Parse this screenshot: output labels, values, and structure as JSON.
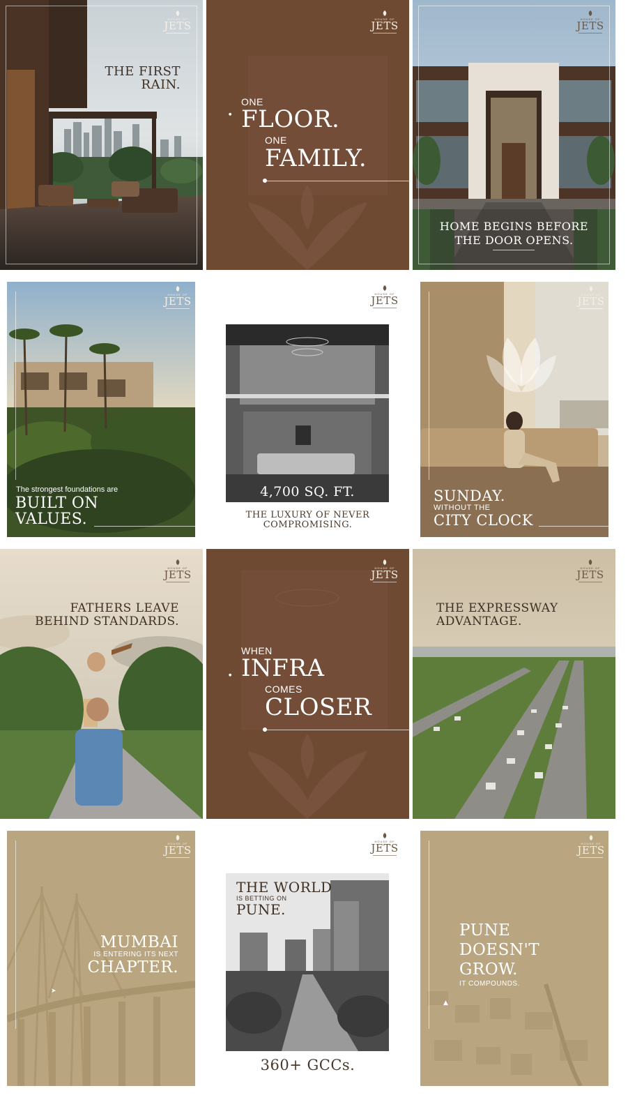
{
  "brand": {
    "house": "HOUSE OF",
    "name": "JETS"
  },
  "tiles": {
    "rain": {
      "line1": "THE FIRST",
      "line2": "RAIN."
    },
    "floor": {
      "one_a": "ONE",
      "floor": "FLOOR.",
      "one_b": "ONE",
      "family": "FAMILY."
    },
    "home": {
      "line1": "HOME BEGINS BEFORE",
      "line2": "THE DOOR OPENS."
    },
    "values": {
      "small": "The strongest foundations are",
      "line1": "BUILT ON",
      "line2": "VALUES."
    },
    "sqft": {
      "big": "4,700 SQ. FT.",
      "cap1": "THE LUXURY OF NEVER",
      "cap2": "COMPROMISING."
    },
    "sunday": {
      "line1": "SUNDAY.",
      "small": "WITHOUT THE",
      "line2": "CITY CLOCK"
    },
    "fathers": {
      "line1": "FATHERS LEAVE",
      "line2": "BEHIND STANDARDS."
    },
    "infra": {
      "when": "WHEN",
      "infra": "INFRA",
      "comes": "COMES",
      "closer": "CLOSER"
    },
    "expressway": {
      "line1": "THE EXPRESSWAY",
      "line2": "ADVANTAGE."
    },
    "mumbai": {
      "line1": "MUMBAI",
      "small": "IS ENTERING ITS NEXT",
      "line2": "CHAPTER."
    },
    "world": {
      "line1": "THE WORLD",
      "small": "IS BETTING ON",
      "line2": "PUNE.",
      "caption": "360+ GCCs."
    },
    "pune": {
      "line1": "PUNE",
      "line2": "DOESN'T",
      "line3": "GROW.",
      "small": "IT COMPOUNDS."
    }
  },
  "colors": {
    "brown": "#6f4a33",
    "sand": "#b9a57f",
    "cream": "#f4efe6",
    "white": "#ffffff"
  }
}
